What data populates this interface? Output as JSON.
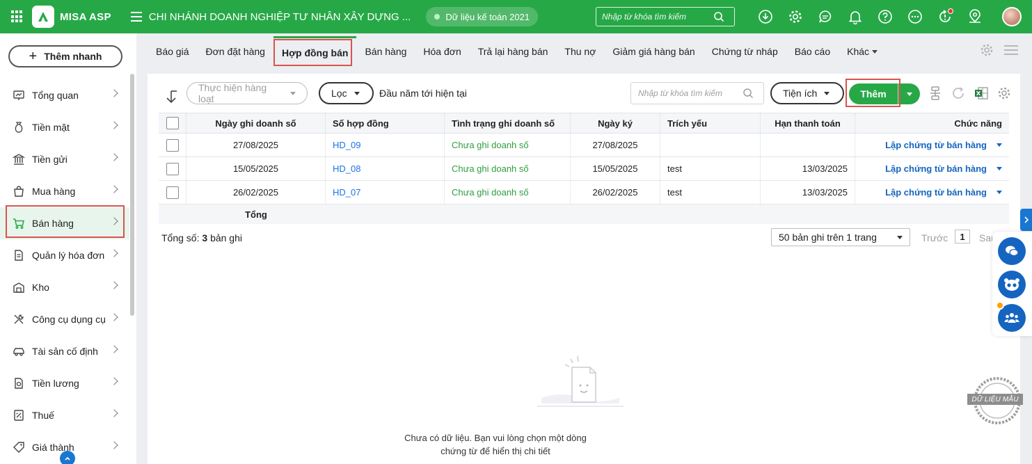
{
  "header": {
    "logo_text": "MISA ASP",
    "branch_name": "CHI NHÁNH DOANH NGHIỆP TƯ NHÂN XÂY DỰNG ...",
    "data_badge": "Dữ liệu kế toán 2021",
    "search_placeholder": "Nhập từ khóa tìm kiếm",
    "icons": [
      "download-icon",
      "settings-icon",
      "chat-icon",
      "bell-icon",
      "help-icon",
      "more-icon",
      "update-icon",
      "location-icon"
    ],
    "accent_color": "#27a847"
  },
  "sidebar": {
    "quick_add_label": "Thêm nhanh",
    "items": [
      {
        "label": "Tổng quan",
        "icon": "dashboard-icon"
      },
      {
        "label": "Tiền mặt",
        "icon": "money-bag-icon"
      },
      {
        "label": "Tiền gửi",
        "icon": "bank-icon"
      },
      {
        "label": "Mua hàng",
        "icon": "shopping-bag-icon"
      },
      {
        "label": "Bán hàng",
        "icon": "cart-icon",
        "active": true
      },
      {
        "label": "Quản lý hóa đơn",
        "icon": "invoice-icon"
      },
      {
        "label": "Kho",
        "icon": "warehouse-icon"
      },
      {
        "label": "Công cụ dụng cụ",
        "icon": "tools-icon"
      },
      {
        "label": "Tài sản cố định",
        "icon": "car-icon"
      },
      {
        "label": "Tiền lương",
        "icon": "payroll-icon"
      },
      {
        "label": "Thuế",
        "icon": "tax-icon"
      },
      {
        "label": "Giá thành",
        "icon": "cost-icon"
      }
    ]
  },
  "tabs": [
    {
      "label": "Báo giá"
    },
    {
      "label": "Đơn đặt hàng"
    },
    {
      "label": "Hợp đồng bán",
      "active": true
    },
    {
      "label": "Bán hàng"
    },
    {
      "label": "Hóa đơn"
    },
    {
      "label": "Trả lại hàng bán"
    },
    {
      "label": "Thu nợ"
    },
    {
      "label": "Giảm giá hàng bán"
    },
    {
      "label": "Chứng từ nháp"
    },
    {
      "label": "Báo cáo"
    },
    {
      "label": "Khác"
    }
  ],
  "toolbar": {
    "batch_label": "Thực hiện hàng loạt",
    "filter_label": "Lọc",
    "period_label": "Đầu năm tới hiện tại",
    "search_placeholder": "Nhập từ khóa tìm kiếm",
    "utilities_label": "Tiện ích",
    "add_label": "Thêm"
  },
  "table": {
    "columns": [
      "Ngày ghi doanh số",
      "Số hợp đồng",
      "Tình trạng ghi doanh số",
      "Ngày ký",
      "Trích yếu",
      "Hạn thanh toán",
      "Chức năng"
    ],
    "rows": [
      {
        "sales_date": "27/08/2025",
        "contract_no": "HD_09",
        "status": "Chưa ghi doanh số",
        "sign_date": "27/08/2025",
        "summary": "",
        "due_date": "",
        "action": "Lập chứng từ bán hàng"
      },
      {
        "sales_date": "15/05/2025",
        "contract_no": "HD_08",
        "status": "Chưa ghi doanh số",
        "sign_date": "15/05/2025",
        "summary": "test",
        "due_date": "13/03/2025",
        "action": "Lập chứng từ bán hàng"
      },
      {
        "sales_date": "26/02/2025",
        "contract_no": "HD_07",
        "status": "Chưa ghi doanh số",
        "sign_date": "26/02/2025",
        "summary": "test",
        "due_date": "13/03/2025",
        "action": "Lập chứng từ bán hàng"
      }
    ],
    "total_label": "Tổng"
  },
  "footer": {
    "total_prefix": "Tổng số:",
    "total_count": "3",
    "total_suffix": "bản ghi",
    "page_size_label": "50 bản ghi trên 1 trang",
    "prev_label": "Trước",
    "page_number": "1",
    "next_label": "Sau"
  },
  "empty_state": {
    "line1": "Chưa có dữ liệu. Bạn vui lòng chọn một dòng",
    "line2": "chứng từ để hiển thị chi tiết"
  },
  "stamp_label": "DỮ LIỆU MẪU"
}
